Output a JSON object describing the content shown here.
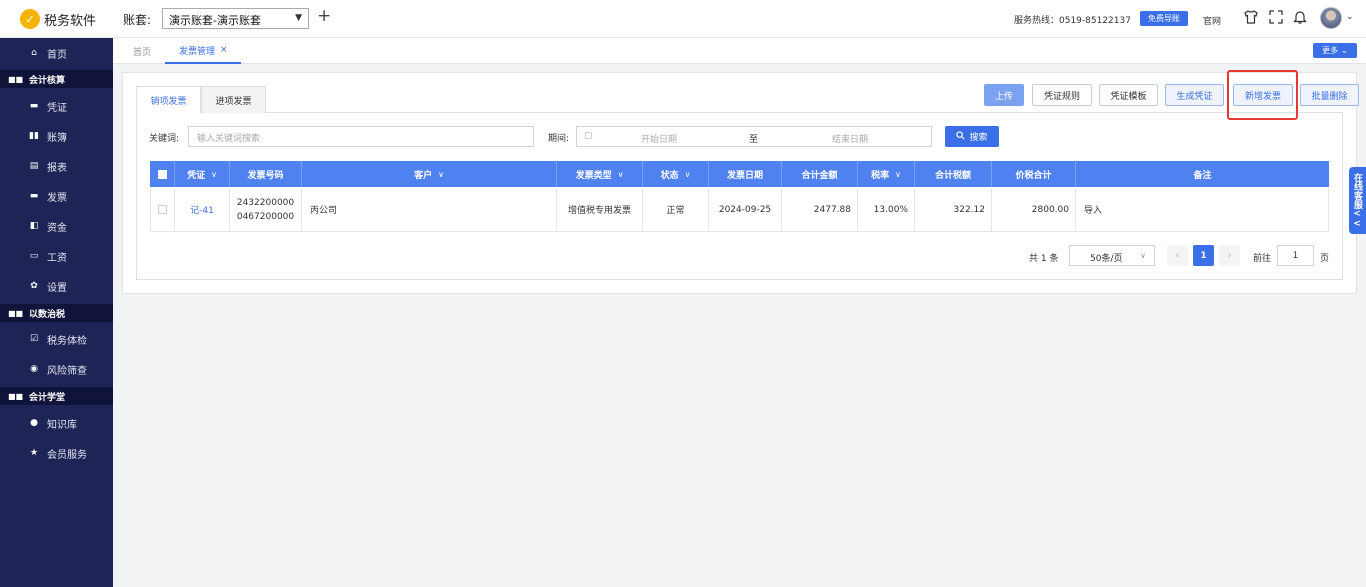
{
  "app": {
    "logo_glyph": "✓",
    "name": "税务软件"
  },
  "account": {
    "label": "账套:",
    "selected": "演示账套-演示账套",
    "add_glyph": "+"
  },
  "header": {
    "hotline": "服务热线：0519-85122137",
    "free_button": "免费导账",
    "site_link": "官网",
    "icons": [
      "shirt-icon",
      "fullscreen-icon",
      "bell-icon",
      "avatar"
    ]
  },
  "sidebar": {
    "home": "首页",
    "sections": [
      {
        "title": "会计核算",
        "items": [
          "凭证",
          "账簿",
          "报表",
          "发票",
          "资金",
          "工资",
          "设置"
        ]
      },
      {
        "title": "以数治税",
        "items": [
          "税务体检",
          "风险筛查"
        ]
      },
      {
        "title": "会计学堂",
        "items": [
          "知识库",
          "会员服务"
        ]
      }
    ]
  },
  "tabs": {
    "home": "首页",
    "active": "发票管理",
    "close": "×",
    "more": "更多"
  },
  "subtabs": {
    "sales": "销项发票",
    "purchase": "进项发票"
  },
  "actions": {
    "upload": "上传",
    "voucher_rules": "凭证规则",
    "voucher_template": "凭证模板",
    "generate_voucher": "生成凭证",
    "new_invoice": "新增发票",
    "batch_delete": "批量删除"
  },
  "filters": {
    "keyword_label": "关键词:",
    "keyword_placeholder": "输入关键词搜索",
    "period_label": "期间:",
    "start_placeholder": "开始日期",
    "separator": "至",
    "end_placeholder": "结束日期",
    "search_button": "搜索"
  },
  "table": {
    "columns": [
      "凭证",
      "发票号码",
      "客户",
      "发票类型",
      "状态",
      "发票日期",
      "合计金额",
      "税率",
      "合计税额",
      "价税合计",
      "备注"
    ],
    "rows": [
      {
        "voucher": "记-41",
        "invoice_no_1": "2432200000",
        "invoice_no_2": "0467200000",
        "customer": "丙公司",
        "type": "增值税专用发票",
        "status": "正常",
        "date": "2024-09-25",
        "amount": "2477.88",
        "tax_rate": "13.00%",
        "tax": "322.12",
        "total": "2800.00",
        "remark": "导入"
      }
    ]
  },
  "pagination": {
    "total": "共 1 条",
    "page_size": "50条/页",
    "prev": "‹",
    "current": "1",
    "next": "›",
    "goto_label": "前往",
    "goto_value": "1",
    "page_suffix": "页"
  },
  "chat": {
    "label": "在线客服<<"
  },
  "colors": {
    "accent": "#3a6fe8",
    "sidebar": "#1e2456",
    "table_header": "#4f82f0",
    "highlight": "#e53935"
  }
}
